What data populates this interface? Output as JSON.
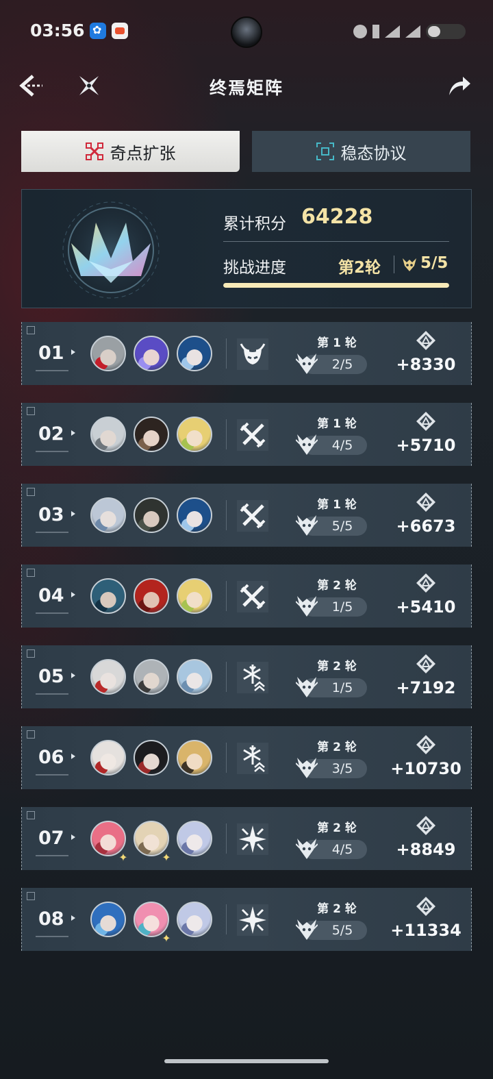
{
  "status_bar": {
    "time": "03:56"
  },
  "nav": {
    "title": "终焉矩阵"
  },
  "tabs": [
    {
      "label": "奇点扩张",
      "active": true
    },
    {
      "label": "稳态协议",
      "active": false
    }
  ],
  "summary": {
    "score_label": "累计积分",
    "score_value": "64228",
    "progress_label": "挑战进度",
    "round_value": "第2轮",
    "progress_value": "5/5",
    "progress_fraction": 1.0
  },
  "rows": [
    {
      "index": "01",
      "round": "第 1 轮",
      "count": "2/5",
      "score": "+8330",
      "element": "dark-icon",
      "avatars": [
        {
          "hair": "#9aa0a4",
          "skin": "#d9cfc8",
          "accent": "#c21e2a",
          "star": false
        },
        {
          "hair": "#5a4cc4",
          "skin": "#e8d4d2",
          "accent": "#9a8ef0",
          "star": false
        },
        {
          "hair": "#1d4f8a",
          "skin": "#e9e2e2",
          "accent": "#9ec6ea",
          "star": false
        }
      ]
    },
    {
      "index": "02",
      "round": "第 1 轮",
      "count": "4/5",
      "score": "+5710",
      "element": "physical-icon",
      "avatars": [
        {
          "hair": "#c9cfd4",
          "skin": "#e1d8d2",
          "accent": "#6e757b",
          "star": false
        },
        {
          "hair": "#2d2420",
          "skin": "#e5d2c7",
          "accent": "#7a5f4a",
          "star": false
        },
        {
          "hair": "#e7cf73",
          "skin": "#f1dfc9",
          "accent": "#a7c250",
          "star": false
        }
      ]
    },
    {
      "index": "03",
      "round": "第 1 轮",
      "count": "5/5",
      "score": "+6673",
      "element": "physical-icon",
      "avatars": [
        {
          "hair": "#bcc7d6",
          "skin": "#e6dfdc",
          "accent": "#6e89a9",
          "star": false
        },
        {
          "hair": "#2f3330",
          "skin": "#d8c9bf",
          "accent": "#4a5248",
          "star": false
        },
        {
          "hair": "#1d4f8a",
          "skin": "#e9e2e2",
          "accent": "#9ec6ea",
          "star": false
        }
      ]
    },
    {
      "index": "04",
      "round": "第 2 轮",
      "count": "1/5",
      "score": "+5410",
      "element": "physical-icon",
      "avatars": [
        {
          "hair": "#2e5f78",
          "skin": "#d7c8bd",
          "accent": "#133144",
          "star": false
        },
        {
          "hair": "#b3241e",
          "skin": "#e1c3b3",
          "accent": "#6b1612",
          "star": false
        },
        {
          "hair": "#e7cf73",
          "skin": "#f1dfc9",
          "accent": "#a7c250",
          "star": false
        }
      ]
    },
    {
      "index": "05",
      "round": "第 2 轮",
      "count": "1/5",
      "score": "+7192",
      "element": "ice-icon",
      "avatars": [
        {
          "hair": "#d8d8d8",
          "skin": "#e9e2df",
          "accent": "#b92a2a",
          "star": false
        },
        {
          "hair": "#aeb3b7",
          "skin": "#e1d7cf",
          "accent": "#3c3c3c",
          "star": false
        },
        {
          "hair": "#a8c6df",
          "skin": "#eae6e6",
          "accent": "#6d8fb0",
          "star": false
        }
      ]
    },
    {
      "index": "06",
      "round": "第 2 轮",
      "count": "3/5",
      "score": "+10730",
      "element": "ice-icon",
      "avatars": [
        {
          "hair": "#e5e1de",
          "skin": "#efe8e3",
          "accent": "#b02828",
          "star": false
        },
        {
          "hair": "#1c1c1f",
          "skin": "#e4d8d1",
          "accent": "#9a2a2a",
          "star": false
        },
        {
          "hair": "#d9b46a",
          "skin": "#f0dcc4",
          "accent": "#3e3426",
          "star": false
        }
      ]
    },
    {
      "index": "07",
      "round": "第 2 轮",
      "count": "4/5",
      "score": "+8849",
      "element": "lightning-icon",
      "avatars": [
        {
          "hair": "#e96f86",
          "skin": "#f3dcd6",
          "accent": "#a7313f",
          "star": true
        },
        {
          "hair": "#e3d3b5",
          "skin": "#f1e2d5",
          "accent": "#7c6a52",
          "star": true
        },
        {
          "hair": "#c0c9e6",
          "skin": "#eee9ea",
          "accent": "#6b77a8",
          "star": false
        }
      ]
    },
    {
      "index": "08",
      "round": "第 2 轮",
      "count": "5/5",
      "score": "+11334",
      "element": "lightning-icon",
      "avatars": [
        {
          "hair": "#2f6fbe",
          "skin": "#e6dbd6",
          "accent": "#6fb4e6",
          "star": false
        },
        {
          "hair": "#f08fb0",
          "skin": "#f5e0dd",
          "accent": "#4fb1c5",
          "star": true
        },
        {
          "hair": "#c0c9e6",
          "skin": "#eee9ea",
          "accent": "#6b77a8",
          "star": false
        }
      ]
    }
  ]
}
